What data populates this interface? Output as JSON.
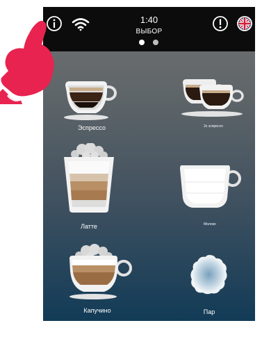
{
  "header": {
    "time": "1:40",
    "title": "ВЫБОР",
    "page_dots": {
      "count": 2,
      "active_index": 0
    }
  },
  "icons": {
    "info": "info-icon",
    "wifi": "wifi-icon",
    "alert": "alert-icon",
    "language": "uk-flag-icon"
  },
  "drinks": [
    {
      "id": "espresso",
      "label": "Эспрессо"
    },
    {
      "id": "double-espresso",
      "label": "2x эспрессо"
    },
    {
      "id": "latte",
      "label": "Латте"
    },
    {
      "id": "milk",
      "label": "Молоко"
    },
    {
      "id": "cappuccino",
      "label": "Капучино"
    },
    {
      "id": "steam",
      "label": "Пар"
    }
  ],
  "colors": {
    "topbar": "#0c0c0c",
    "background_top": "#727272",
    "background_bottom": "#123b57",
    "hand": "#e8234f",
    "coffee": "#5a3b26",
    "latte": "#b98f66"
  }
}
